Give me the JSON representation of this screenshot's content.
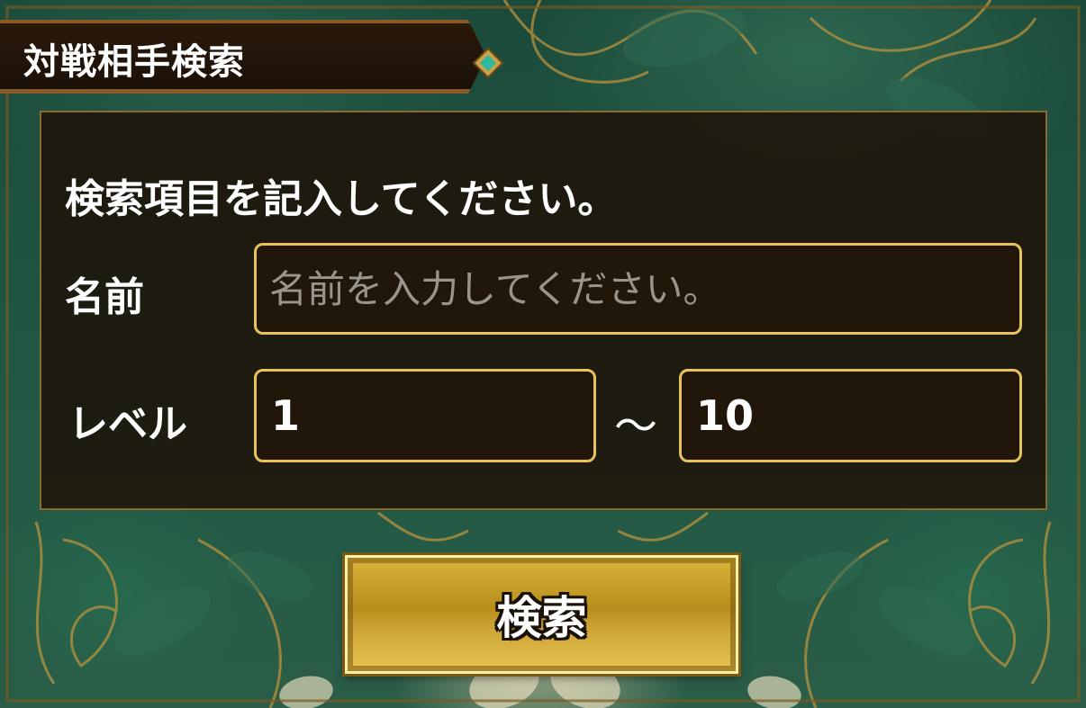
{
  "header": {
    "title": "対戦相手検索"
  },
  "form": {
    "instruction": "検索項目を記入してください。",
    "name_label": "名前",
    "name_value": "",
    "name_placeholder": "名前を入力してください。",
    "level_label": "レベル",
    "level_min": "1",
    "level_separator": "～",
    "level_max": "10"
  },
  "actions": {
    "search_label": "検索"
  },
  "colors": {
    "accent_gold": "#e9c35a",
    "panel_bg": "#1e1208",
    "background_green": "#1f5442"
  }
}
